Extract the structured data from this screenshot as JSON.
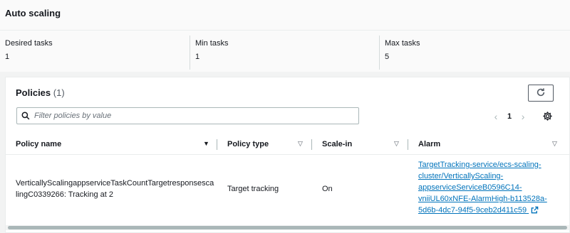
{
  "section": {
    "title": "Auto scaling"
  },
  "stats": [
    {
      "label": "Desired tasks",
      "value": "1"
    },
    {
      "label": "Min tasks",
      "value": "1"
    },
    {
      "label": "Max tasks",
      "value": "5"
    }
  ],
  "policies": {
    "title": "Policies",
    "count": "(1)",
    "search_placeholder": "Filter policies by value",
    "page": "1",
    "columns": [
      "Policy name",
      "Policy type",
      "Scale-in",
      "Alarm"
    ],
    "rows": [
      {
        "name_line1": "VerticallyScalingappserviceTaskCountTargetresponsesca",
        "name_line2": "lingC0339266: Tracking at 2",
        "type": "Target tracking",
        "scale_in": "On",
        "alarm_lines": [
          "TargetTracking-service/ecs-scaling-",
          "cluster/VerticallyScaling-",
          "appserviceServiceB0596C14-",
          "vniiUL60xNFE-AlarmHigh-b113528a-",
          "5d6b-4dc7-94f5-9ceb2d411c59"
        ]
      }
    ]
  },
  "colors": {
    "link": "#0073bb",
    "text": "#16191f",
    "border": "#aab7b8"
  }
}
